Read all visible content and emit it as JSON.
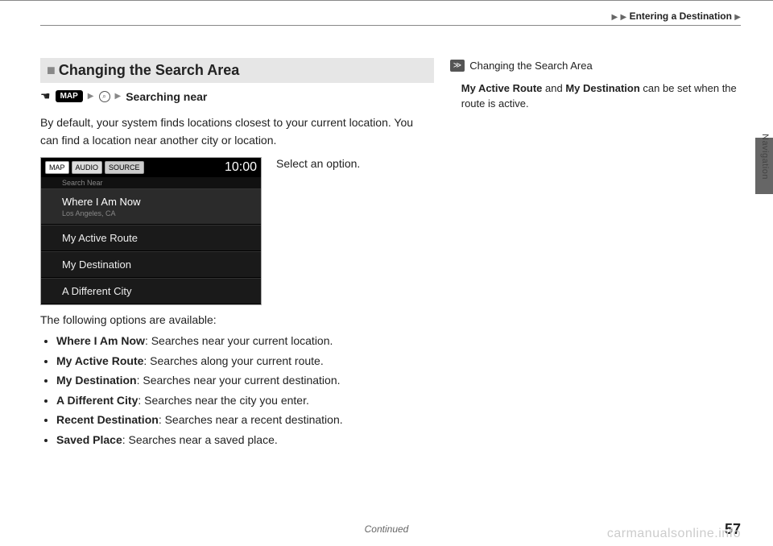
{
  "header": {
    "breadcrumb_label": "Entering a Destination"
  },
  "sidebar": {
    "label": "Navigation"
  },
  "main": {
    "heading": "Changing the Search Area",
    "path_chip": "MAP",
    "path_end": "Searching near",
    "intro": "By default, your system finds locations closest to your current location. You can find a location near another city or location.",
    "instruction": "Select an option.",
    "options_lead": "The following options are available:",
    "options": [
      {
        "label": "Where I Am Now",
        "desc": ": Searches near your current location."
      },
      {
        "label": "My Active Route",
        "desc": ": Searches along your current route."
      },
      {
        "label": "My Destination",
        "desc": ": Searches near your current destination."
      },
      {
        "label": "A Different City",
        "desc": ": Searches near the city you enter."
      },
      {
        "label": "Recent Destination",
        "desc": ": Searches near a recent destination."
      },
      {
        "label": "Saved Place",
        "desc": ": Searches near a saved place."
      }
    ]
  },
  "screenshot": {
    "tabs": {
      "map": "MAP",
      "audio": "AUDIO",
      "source": "SOURCE"
    },
    "clock": "10:00",
    "subhead": "Search Near",
    "items": {
      "where_now": "Where I Am Now",
      "where_now_sub": "Los Angeles, CA",
      "active_route": "My Active Route",
      "destination": "My Destination",
      "diff_city": "A Different City"
    }
  },
  "side": {
    "heading": "Changing the Search Area",
    "body_pre": "My Active Route",
    "body_mid": " and ",
    "body_dest": "My Destination",
    "body_post": " can be set when the route is active."
  },
  "footer": {
    "continued": "Continued",
    "page_no": "57",
    "watermark": "carmanualsonline.info"
  }
}
